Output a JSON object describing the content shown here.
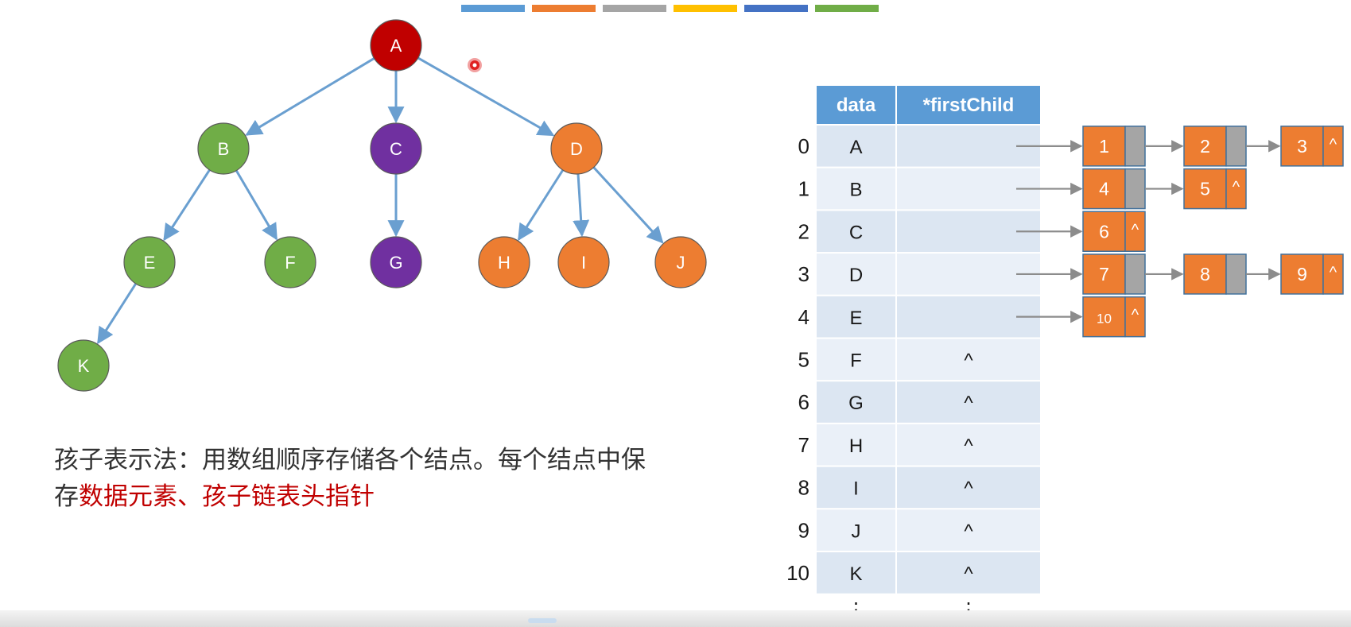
{
  "color_bar": [
    "#5b9bd5",
    "#ed7d31",
    "#a5a5a5",
    "#ffc000",
    "#4472c4",
    "#70ad47"
  ],
  "colors": {
    "edge": "#6a9fd0",
    "red": "#c00000",
    "green": "#70ad47",
    "purple": "#7030a0",
    "orange": "#ed7d31",
    "header": "#5b9bd5",
    "cell_light": "#dce6f2",
    "cell_lighter": "#eaf0f8",
    "ll_orange": "#ed7d31",
    "ll_gray": "#a5a5a5"
  },
  "tree": {
    "nodes": [
      {
        "id": "A",
        "label": "A",
        "color": "red"
      },
      {
        "id": "B",
        "label": "B",
        "color": "green"
      },
      {
        "id": "C",
        "label": "C",
        "color": "purple"
      },
      {
        "id": "D",
        "label": "D",
        "color": "orange"
      },
      {
        "id": "E",
        "label": "E",
        "color": "green"
      },
      {
        "id": "F",
        "label": "F",
        "color": "green"
      },
      {
        "id": "G",
        "label": "G",
        "color": "purple"
      },
      {
        "id": "H",
        "label": "H",
        "color": "orange"
      },
      {
        "id": "I",
        "label": "I",
        "color": "orange"
      },
      {
        "id": "J",
        "label": "J",
        "color": "orange"
      },
      {
        "id": "K",
        "label": "K",
        "color": "green"
      }
    ],
    "edges": [
      [
        "A",
        "B"
      ],
      [
        "A",
        "C"
      ],
      [
        "A",
        "D"
      ],
      [
        "B",
        "E"
      ],
      [
        "B",
        "F"
      ],
      [
        "C",
        "G"
      ],
      [
        "D",
        "H"
      ],
      [
        "D",
        "I"
      ],
      [
        "D",
        "J"
      ],
      [
        "E",
        "K"
      ]
    ]
  },
  "table": {
    "headers": [
      "data",
      "*firstChild"
    ],
    "rows": [
      {
        "index": "0",
        "data": "A",
        "firstChild": ""
      },
      {
        "index": "1",
        "data": "B",
        "firstChild": ""
      },
      {
        "index": "2",
        "data": "C",
        "firstChild": ""
      },
      {
        "index": "3",
        "data": "D",
        "firstChild": ""
      },
      {
        "index": "4",
        "data": "E",
        "firstChild": ""
      },
      {
        "index": "5",
        "data": "F",
        "firstChild": "^"
      },
      {
        "index": "6",
        "data": "G",
        "firstChild": "^"
      },
      {
        "index": "7",
        "data": "H",
        "firstChild": "^"
      },
      {
        "index": "8",
        "data": "I",
        "firstChild": "^"
      },
      {
        "index": "9",
        "data": "J",
        "firstChild": "^"
      },
      {
        "index": "10",
        "data": "K",
        "firstChild": "^"
      }
    ],
    "ellipsis": [
      "⋮",
      "⋮"
    ]
  },
  "linked_lists": [
    {
      "row": 0,
      "nodes": [
        "1",
        "2",
        "3"
      ]
    },
    {
      "row": 1,
      "nodes": [
        "4",
        "5"
      ]
    },
    {
      "row": 2,
      "nodes": [
        "6"
      ]
    },
    {
      "row": 3,
      "nodes": [
        "7",
        "8",
        "9"
      ]
    },
    {
      "row": 4,
      "nodes": [
        "10"
      ]
    }
  ],
  "null_symbol": "^",
  "description": {
    "line1": "孩子表示法：用数组顺序存储各个结点。每个结点中保",
    "line2_prefix": "存",
    "line2_highlight": "数据元素、孩子链表头指针"
  }
}
